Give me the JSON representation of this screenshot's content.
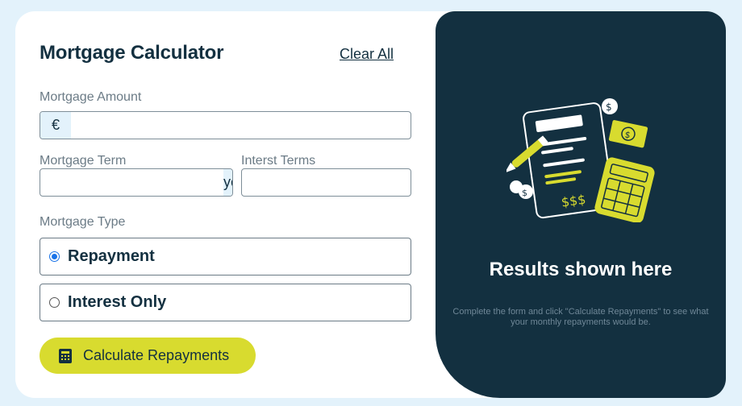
{
  "header": {
    "title": "Mortgage Calculator",
    "clear_label": "Clear All"
  },
  "form": {
    "amount": {
      "label": "Mortgage Amount",
      "prefix": "€",
      "value": ""
    },
    "term": {
      "label": "Mortgage Term",
      "suffix": "years",
      "value": ""
    },
    "rate": {
      "label": "Interst Terms",
      "suffix": "%",
      "value": ""
    },
    "type": {
      "label": "Mortgage Type",
      "options": [
        {
          "label": "Repayment",
          "checked": true
        },
        {
          "label": "Interest Only",
          "checked": false
        }
      ]
    },
    "submit_label": "Calculate Repayments"
  },
  "results": {
    "title": "Results shown here",
    "text": "Complete the form and click \"Calculate Repayments\" to see what your monthly repayments would be.",
    "illustration_icon": "empty-results-illustration"
  },
  "colors": {
    "background": "#e3f2fb",
    "primary_dark": "#133040",
    "accent_lime": "#d8db2f",
    "muted_text": "#6b7b86",
    "radio_selected": "#1a73e8"
  }
}
